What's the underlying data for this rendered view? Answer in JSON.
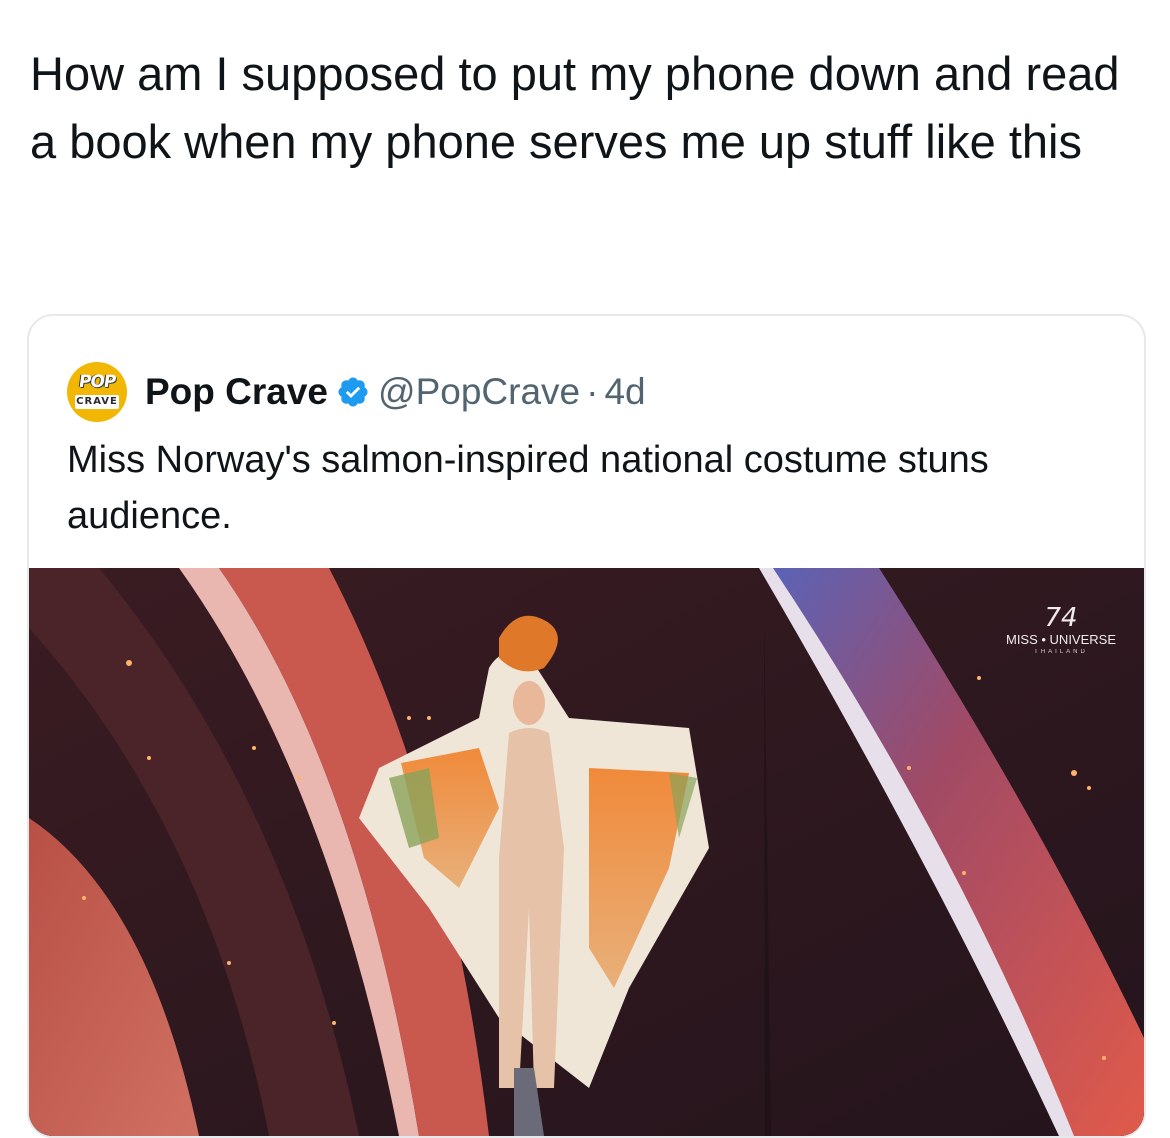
{
  "post": {
    "text": "How am I supposed to put my phone down and read a book when my phone serves me up stuff like this"
  },
  "quoted_post": {
    "avatar": {
      "top": "POP",
      "bottom": "CRAVE"
    },
    "author_name": "Pop Crave",
    "verified_icon": "verified-badge-icon",
    "handle": "@PopCrave",
    "separator": "·",
    "time": "4d",
    "text": "Miss Norway's salmon-inspired national costume stuns audience.",
    "media": {
      "watermark_number": "74",
      "watermark_brand": "MISS • UNIVERSE",
      "watermark_sub": "THAILAND"
    }
  },
  "colors": {
    "text_primary": "#0f1419",
    "text_secondary": "#536471",
    "verified": "#1d9bf0",
    "card_border": "#e6e9ec"
  }
}
